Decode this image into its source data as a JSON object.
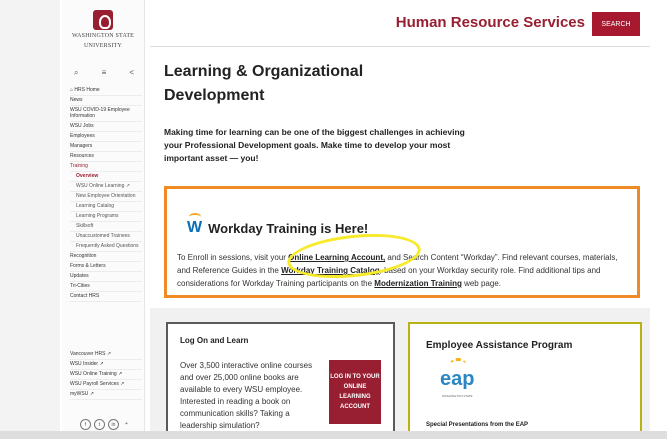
{
  "header": {
    "site_title": "Human Resource Services",
    "search_label": "SEARCH"
  },
  "logo": {
    "line1": "WASHINGTON STATE",
    "line2": "UNIVERSITY"
  },
  "sidebar": {
    "items": [
      {
        "label": "⌂ HRS Home"
      },
      {
        "label": "News"
      },
      {
        "label": "WSU COVID-19 Employee Information"
      },
      {
        "label": "WSU Jobs"
      },
      {
        "label": "Employees"
      },
      {
        "label": "Managers"
      },
      {
        "label": "Resources"
      },
      {
        "label": "Training"
      },
      {
        "label": "Overview"
      },
      {
        "label": "WSU Online Learning ↗"
      },
      {
        "label": "New Employee Orientation"
      },
      {
        "label": "Learning Catalog"
      },
      {
        "label": "Learning Programs"
      },
      {
        "label": "Skillsoft"
      },
      {
        "label": "Unaccustomed Trainees"
      },
      {
        "label": "Frequently Asked Questions"
      },
      {
        "label": "Recognition"
      },
      {
        "label": "Forms & Letters"
      },
      {
        "label": "Updates"
      },
      {
        "label": "Tri-Cities"
      },
      {
        "label": "Contact HRS"
      }
    ],
    "footer_links": [
      {
        "label": "Vancouver HRS ↗"
      },
      {
        "label": "WSU Insider ↗"
      },
      {
        "label": "WSU Online Training ↗"
      },
      {
        "label": "WSU Payroll Services ↗"
      },
      {
        "label": "myWSU ↗"
      }
    ],
    "social": [
      "f",
      "t",
      "in",
      "+"
    ]
  },
  "main": {
    "title": "Learning & Organizational Development",
    "intro": "Making time for learning can be one of the biggest challenges in achieving your Professional Development goals. Make time to develop your most important asset — you!"
  },
  "workday": {
    "logo_letter": "W",
    "title": "Workday Training is Here!",
    "text1": "To Enroll in sessions, visit your ",
    "link1": "Online Learning Account,",
    "text2": " and Search Content “Workday”. Find relevant courses, materials, and Reference Guides in the ",
    "link2": "Workday Training Catalog",
    "text3": ", based on your Workday security role. Find additional tips and considerations for Workday Training participants on the ",
    "link3": "Modernization Training",
    "text4": " web page."
  },
  "logon": {
    "title": "Log On and Learn",
    "text": "Over 3,500 interactive online courses and over 25,000 online books are available to every WSU employee. Interested in reading a book on communication skills? Taking a leadership simulation?",
    "button": "LOG IN TO YOUR ONLINE LEARNING ACCOUNT"
  },
  "eap": {
    "title": "Employee Assistance Program",
    "logo_text": "eap",
    "logo_sub": "WASHINGTON STATE",
    "footer": "Special Presentations from the EAP"
  },
  "colors": {
    "brand": "#981e32",
    "workday_border": "#f08a24",
    "highlight": "#f7ea2a",
    "eap_border": "#b9b213"
  }
}
